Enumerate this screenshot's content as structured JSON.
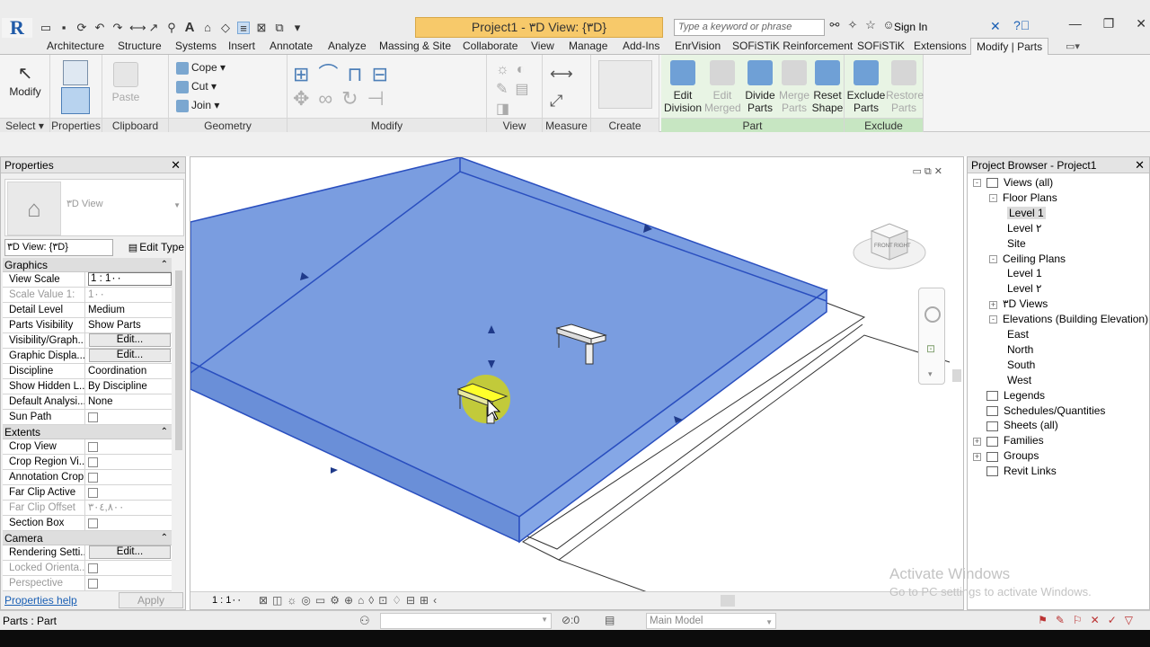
{
  "app": {
    "logo": "R",
    "doc_title": "Project1 - ۳D View: {۳D}",
    "search_placeholder": "Type a keyword or phrase",
    "sign_in": "Sign In"
  },
  "tabs": [
    "Architecture",
    "Structure",
    "Systems",
    "Insert",
    "Annotate",
    "Analyze",
    "Massing & Site",
    "Collaborate",
    "View",
    "Manage",
    "Add-Ins",
    "EnrVision",
    "SOFiSTiK Reinforcement",
    "SOFiSTiK",
    "Extensions",
    "Modify | Parts"
  ],
  "ribbon": {
    "select": {
      "modify": "Modify",
      "title": "Select ▾"
    },
    "properties": {
      "title": "Properties"
    },
    "clipboard": {
      "paste": "Paste",
      "title": "Clipboard"
    },
    "geometry": {
      "cope": "Cope",
      "cut": "Cut",
      "join": "Join",
      "title": "Geometry"
    },
    "modify": {
      "title": "Modify"
    },
    "view": {
      "title": "View"
    },
    "measure": {
      "title": "Measure"
    },
    "create": {
      "title": "Create"
    },
    "part": {
      "edit_division": "Edit Division",
      "edit_merged": "Edit Merged",
      "divide_parts": "Divide Parts",
      "merge_parts": "Merge Parts",
      "reset_shape": "Reset Shape",
      "title": "Part"
    },
    "exclude": {
      "exclude_parts": "Exclude Parts",
      "restore_parts": "Restore Parts",
      "title": "Exclude"
    }
  },
  "properties_panel": {
    "title": "Properties",
    "type_name": "۳D View",
    "instance": "۳D View: {۳D}",
    "edit_type": "Edit Type",
    "groups": [
      {
        "name": "Graphics",
        "rows": [
          {
            "k": "View Scale",
            "v": "1 : 1۰۰",
            "kind": "input"
          },
          {
            "k": "Scale Value  1:",
            "v": "1۰۰",
            "kind": "gray"
          },
          {
            "k": "Detail Level",
            "v": "Medium"
          },
          {
            "k": "Parts Visibility",
            "v": "Show Parts"
          },
          {
            "k": "Visibility/Graph...",
            "v": "Edit...",
            "kind": "button"
          },
          {
            "k": "Graphic Displa...",
            "v": "Edit...",
            "kind": "button"
          },
          {
            "k": "Discipline",
            "v": "Coordination"
          },
          {
            "k": "Show Hidden L...",
            "v": "By Discipline"
          },
          {
            "k": "Default Analysi...",
            "v": "None"
          },
          {
            "k": "Sun Path",
            "v": "",
            "kind": "check"
          }
        ]
      },
      {
        "name": "Extents",
        "rows": [
          {
            "k": "Crop View",
            "v": "",
            "kind": "check"
          },
          {
            "k": "Crop Region Vi...",
            "v": "",
            "kind": "check"
          },
          {
            "k": "Annotation Crop",
            "v": "",
            "kind": "check"
          },
          {
            "k": "Far Clip Active",
            "v": "",
            "kind": "check"
          },
          {
            "k": "Far Clip Offset",
            "v": "۳۰٤,۸۰۰",
            "kind": "gray"
          },
          {
            "k": "Section Box",
            "v": "",
            "kind": "check"
          }
        ]
      },
      {
        "name": "Camera",
        "rows": [
          {
            "k": "Rendering Setti...",
            "v": "Edit...",
            "kind": "button"
          },
          {
            "k": "Locked Orienta...",
            "v": "",
            "kind": "graycheck"
          },
          {
            "k": "Perspective",
            "v": "",
            "kind": "graycheck"
          }
        ]
      }
    ],
    "help": "Properties help",
    "apply": "Apply"
  },
  "view": {
    "scale": "1 : 1۰۰",
    "viewcube_front": "FRONT",
    "viewcube_right": "RIGHT"
  },
  "browser": {
    "title": "Project Browser - Project1",
    "items": [
      {
        "t": "Views (all)",
        "lvl": 0,
        "ex": "-"
      },
      {
        "t": "Floor Plans",
        "lvl": 1,
        "ex": "-"
      },
      {
        "t": "Level 1",
        "lvl": 2,
        "sel": true
      },
      {
        "t": "Level ۲",
        "lvl": 2
      },
      {
        "t": "Site",
        "lvl": 2
      },
      {
        "t": "Ceiling Plans",
        "lvl": 1,
        "ex": "-"
      },
      {
        "t": "Level 1",
        "lvl": 2
      },
      {
        "t": "Level ۲",
        "lvl": 2
      },
      {
        "t": "۳D Views",
        "lvl": 1,
        "ex": "+"
      },
      {
        "t": "Elevations (Building Elevation)",
        "lvl": 1,
        "ex": "-"
      },
      {
        "t": "East",
        "lvl": 2
      },
      {
        "t": "North",
        "lvl": 2
      },
      {
        "t": "South",
        "lvl": 2
      },
      {
        "t": "West",
        "lvl": 2
      },
      {
        "t": "Legends",
        "lvl": 0,
        "icon": true
      },
      {
        "t": "Schedules/Quantities",
        "lvl": 0,
        "icon": true
      },
      {
        "t": "Sheets (all)",
        "lvl": 0,
        "icon": true
      },
      {
        "t": "Families",
        "lvl": 0,
        "ex": "+",
        "icon": true
      },
      {
        "t": "Groups",
        "lvl": 0,
        "ex": "+",
        "icon": true
      },
      {
        "t": "Revit Links",
        "lvl": 0,
        "icon": true
      }
    ]
  },
  "status": {
    "text": "Parts : Part",
    "workset": "Main Model"
  },
  "watermark": {
    "line1": "Activate Windows",
    "line2": "Go to PC settings to activate Windows."
  }
}
